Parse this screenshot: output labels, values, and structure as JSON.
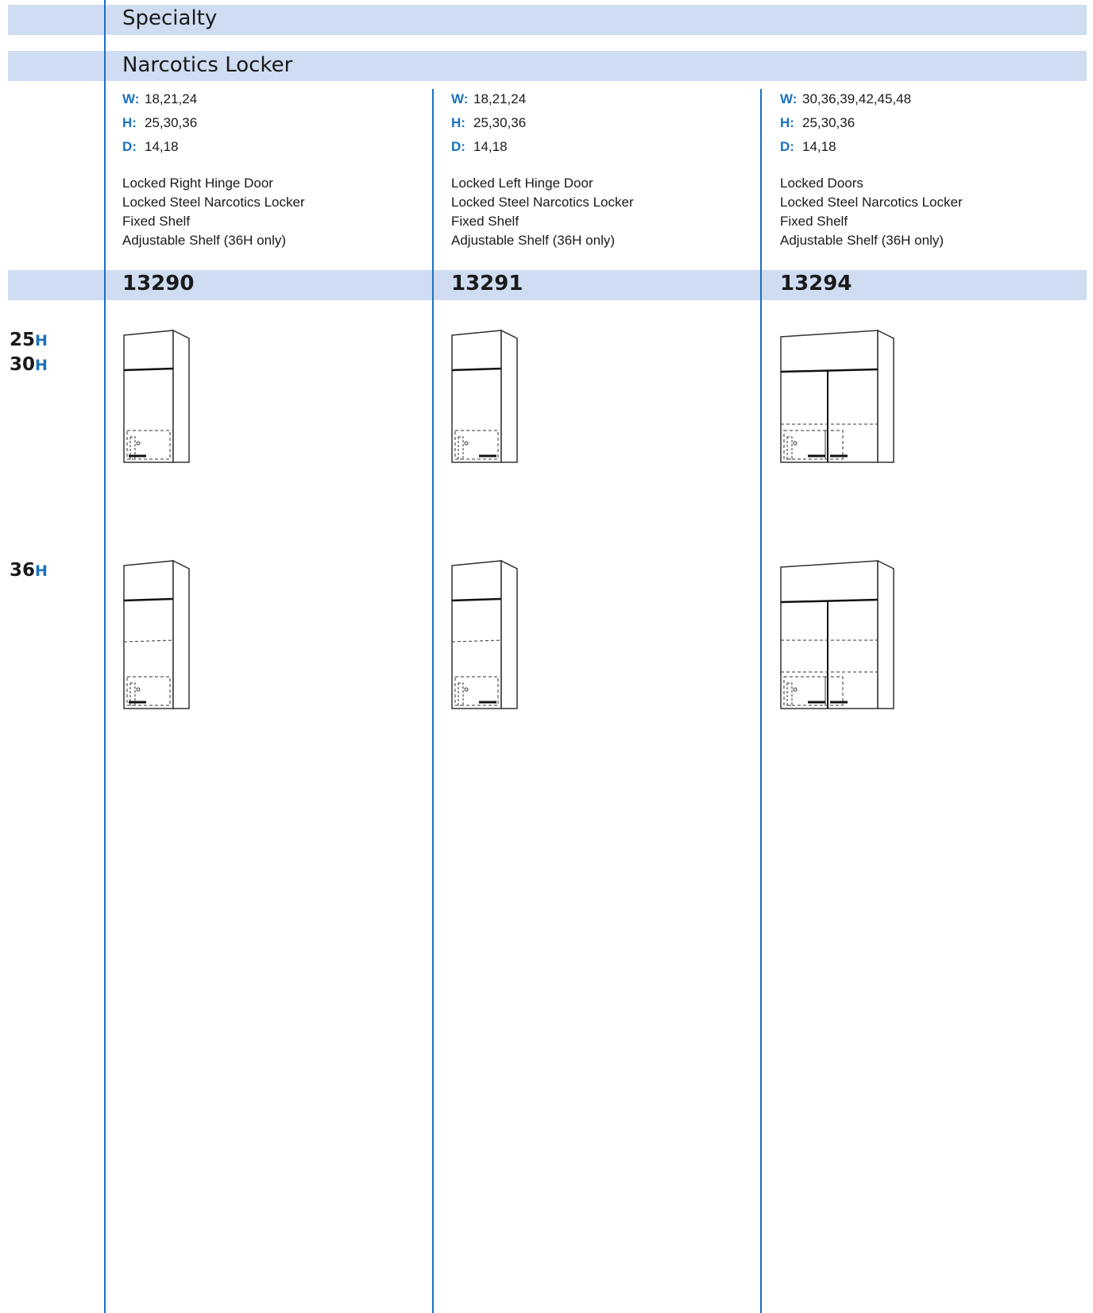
{
  "header": {
    "section_title": "Specialty",
    "subsection_title": "Narcotics Locker"
  },
  "products": [
    {
      "part_number": "13290",
      "w_label": "W:",
      "w_values": "18,21,24",
      "h_label": "H:",
      "h_values": "25,30,36",
      "d_label": "D:",
      "d_values": "14,18",
      "features": [
        "Locked Right Hinge Door",
        "Locked Steel Narcotics Locker",
        "Fixed Shelf",
        "Adjustable Shelf (36H only)"
      ]
    },
    {
      "part_number": "13291",
      "w_label": "W:",
      "w_values": "18,21,24",
      "h_label": "H:",
      "h_values": "25,30,36",
      "d_label": "D:",
      "d_values": "14,18",
      "features": [
        "Locked Left Hinge Door",
        "Locked Steel Narcotics Locker",
        "Fixed Shelf",
        "Adjustable Shelf (36H only)"
      ]
    },
    {
      "part_number": "13294",
      "w_label": "W:",
      "w_values": "30,36,39,42,45,48",
      "h_label": "H:",
      "h_values": "25,30,36",
      "d_label": "D:",
      "d_values": "14,18",
      "features": [
        "Locked Doors",
        "Locked Steel Narcotics Locker",
        "Fixed Shelf",
        "Adjustable Shelf (36H only)"
      ]
    }
  ],
  "height_rows": [
    {
      "labels": [
        {
          "num": "25",
          "unit": "H"
        },
        {
          "num": "30",
          "unit": "H"
        }
      ]
    },
    {
      "labels": [
        {
          "num": "36",
          "unit": "H"
        }
      ]
    }
  ],
  "colors": {
    "band": "#cfdcf2",
    "accent": "#1a72c0",
    "text": "#1a1a1a"
  }
}
